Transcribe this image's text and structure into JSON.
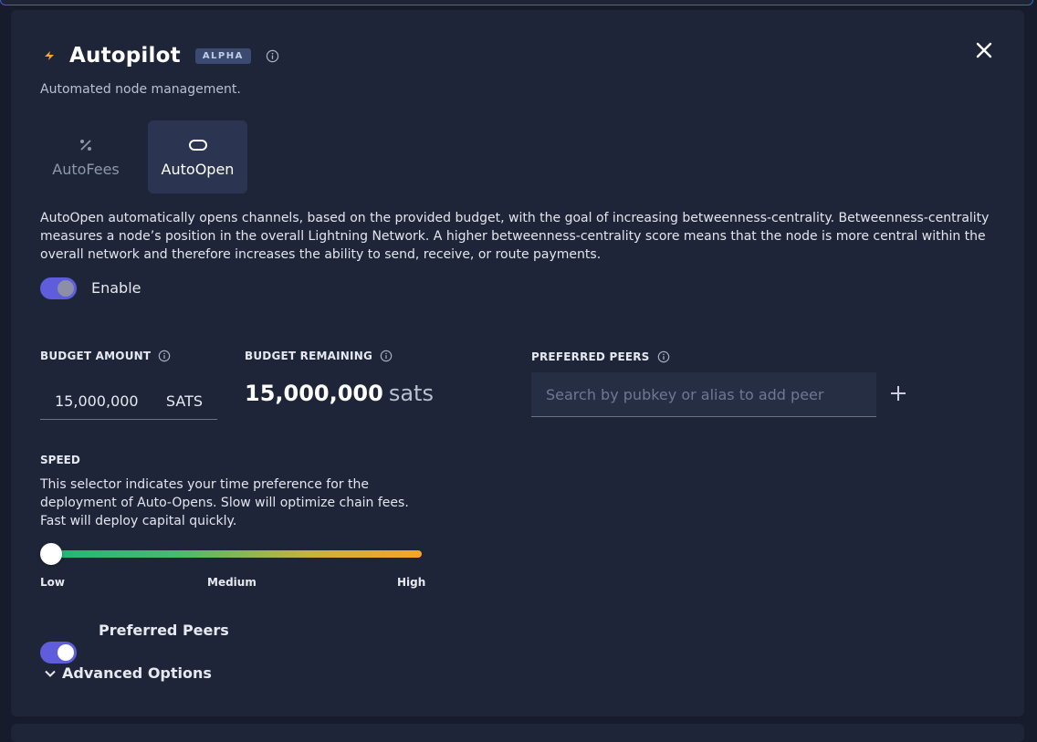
{
  "panel": {
    "title": "Autopilot",
    "badge": "ALPHA",
    "subtitle": "Automated node management.",
    "colors": {
      "accent": "#5f5ddb",
      "bolt": "#f5a623",
      "background": "#1e2538"
    }
  },
  "tabs": [
    {
      "label": "AutoFees",
      "icon": "percent-icon",
      "selected": false
    },
    {
      "label": "AutoOpen",
      "icon": "link-icon",
      "selected": true
    }
  ],
  "description": "AutoOpen automatically opens channels, based on the provided budget, with the goal of increasing betweenness-centrality. Betweenness-centrality measures a node’s position in the overall Lightning Network. A higher betweenness-centrality score means that the node is more central within the overall network and therefore increases the ability to send, receive, or route payments.",
  "enable": {
    "label": "Enable",
    "on": true
  },
  "budget": {
    "label": "BUDGET AMOUNT",
    "value": "15,000,000",
    "unit": "SATS",
    "remaining_label": "BUDGET REMAINING",
    "remaining_value": "15,000,000",
    "remaining_unit": "sats"
  },
  "peers": {
    "label": "PREFERRED PEERS",
    "placeholder": "Search by pubkey or alias to add peer"
  },
  "speed": {
    "label": "SPEED",
    "description": "This selector indicates your time preference for the deployment of Auto-Opens. Slow will optimize chain fees. Fast will deploy capital quickly.",
    "low": "Low",
    "medium": "Medium",
    "high": "High",
    "selected": "Low"
  },
  "preferred_peers_toggle": {
    "label": "Preferred Peers",
    "on": true
  },
  "advanced": {
    "label": "Advanced Options"
  }
}
